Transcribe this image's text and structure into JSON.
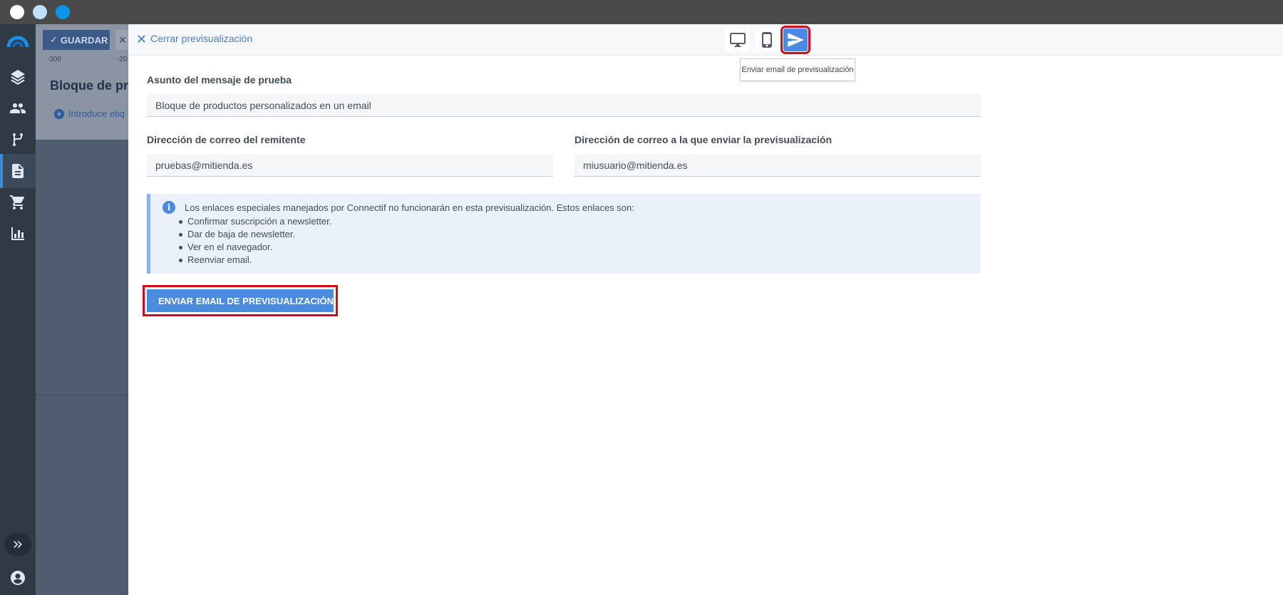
{
  "window": {
    "colors": {
      "titlebar": "#4a4a4a",
      "sidebar": "#2f3a45",
      "accent": "#4a8ae0",
      "highlight": "#d00a1a"
    }
  },
  "sidebar": {
    "items": [
      {
        "icon": "logo-icon"
      },
      {
        "icon": "layers-icon"
      },
      {
        "icon": "people-icon"
      },
      {
        "icon": "workflow-icon"
      },
      {
        "icon": "document-icon",
        "active": true
      },
      {
        "icon": "cart-icon"
      },
      {
        "icon": "bar-chart-icon"
      }
    ],
    "expand_icon": "double-chevron-right-icon",
    "account_icon": "account-circle-icon"
  },
  "background_editor": {
    "save_label": "GUARDAR",
    "ruler_start": "-300",
    "ruler_next": "-20",
    "title": "Bloque de pro",
    "tags_label": "Introduce etiq"
  },
  "preview": {
    "close_label": "Cerrar previsualización",
    "tooltip": "Enviar email de previsualización",
    "subject_label": "Asunto del mensaje de prueba",
    "subject_value": "Bloque de productos personalizados en un email",
    "sender_label": "Dirección de correo del remitente",
    "sender_value": "pruebas@mitienda.es",
    "recipient_label": "Dirección de correo a la que enviar la previsualización",
    "recipient_value": "miusuario@mitienda.es",
    "info_text": "Los enlaces especiales manejados por Connectif no funcionarán en esta previsualización. Estos enlaces son:",
    "info_items": [
      "Confirmar suscripción a newsletter.",
      "Dar de baja de newsletter.",
      "Ver en el navegador.",
      "Reenviar email."
    ],
    "send_button_label": "ENVIAR EMAIL DE PREVISUALIZACIÓN"
  }
}
